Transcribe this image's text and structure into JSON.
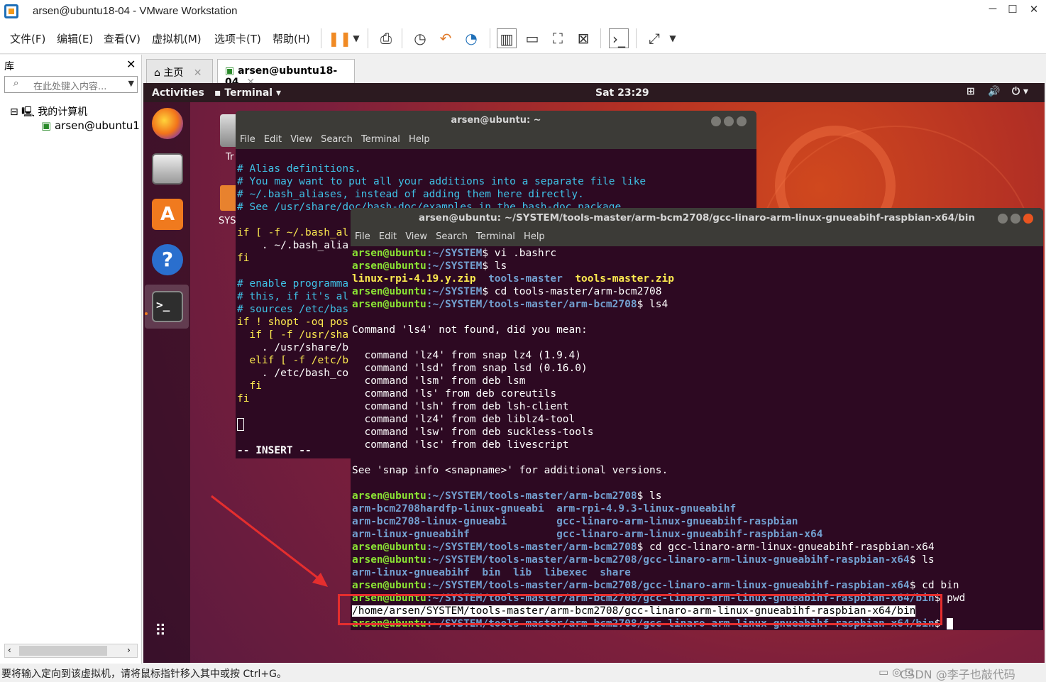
{
  "window": {
    "title": "arsen@ubuntu18-04 - VMware Workstation",
    "min": "─",
    "max": "☐",
    "close": "✕"
  },
  "menu": [
    "文件(F)",
    "编辑(E)",
    "查看(V)",
    "虚拟机(M)",
    "选项卡(T)",
    "帮助(H)"
  ],
  "library": {
    "title": "库",
    "close": "✕",
    "search_placeholder": "在此处键入内容...",
    "root": "我的计算机",
    "vm": "arsen@ubuntu18-04"
  },
  "tabs": [
    {
      "label": "主页"
    },
    {
      "label": "arsen@ubuntu18-04"
    }
  ],
  "ubuntu": {
    "activities": "Activities",
    "app": "Terminal ▾",
    "clock": "Sat 23:29"
  },
  "desktop": {
    "trash_label": "Tr",
    "folder_label": "SYS"
  },
  "term_back": {
    "title": "arsen@ubuntu: ~",
    "menu": "File Edit View Search Terminal Help",
    "lines": [
      "# Alias definitions.",
      "# You may want to put all your additions into a separate file like",
      "# ~/.bash_aliases, instead of adding them here directly.",
      "# See /usr/share/doc/bash-doc/examples in the bash-doc package."
    ],
    "lines2": [
      "if [ -f ~/.bash_al",
      "    . ~/.bash_alia",
      "fi",
      "",
      "# enable programma",
      "# this, if it's al",
      "# sources /etc/bas",
      "if ! shopt -oq pos",
      "  if [ -f /usr/sha",
      "    . /usr/share/b",
      "  elif [ -f /etc/b",
      "    . /etc/bash_co",
      "  fi",
      "fi"
    ],
    "mode": "-- INSERT --"
  },
  "term_front": {
    "title": "arsen@ubuntu: ~/SYSTEM/tools-master/arm-bcm2708/gcc-linaro-arm-linux-gnueabihf-raspbian-x64/bin",
    "menu": "File Edit View Search Terminal Help",
    "prompt_user": "arsen@ubuntu",
    "l1_path": ":~/SYSTEM",
    "l1_cmd": "$ vi .bashrc",
    "l2_path": ":~/SYSTEM",
    "l2_cmd": "$ ls",
    "ls1": [
      "linux-rpi-4.19.y.zip",
      "tools-master",
      "tools-master.zip"
    ],
    "l3_path": ":~/SYSTEM",
    "l3_cmd": "$ cd tools-master/arm-bcm2708",
    "l4_path": ":~/SYSTEM/tools-master/arm-bcm2708",
    "l4_cmd": "$ ls4",
    "notfound": "Command 'ls4' not found, did you mean:",
    "suggest": [
      "  command 'lz4' from snap lz4 (1.9.4)",
      "  command 'lsd' from snap lsd (0.16.0)",
      "  command 'lsm' from deb lsm",
      "  command 'ls' from deb coreutils",
      "  command 'lsh' from deb lsh-client",
      "  command 'lz4' from deb liblz4-tool",
      "  command 'lsw' from deb suckless-tools",
      "  command 'lsc' from deb livescript"
    ],
    "seeinfo": "See 'snap info <snapname>' for additional versions.",
    "l5_path": ":~/SYSTEM/tools-master/arm-bcm2708",
    "l5_cmd": "$ ls",
    "ls2": [
      "arm-bcm2708hardfp-linux-gnueabi  arm-rpi-4.9.3-linux-gnueabihf",
      "arm-bcm2708-linux-gnueabi        gcc-linaro-arm-linux-gnueabihf-raspbian",
      "arm-linux-gnueabihf              gcc-linaro-arm-linux-gnueabihf-raspbian-x64"
    ],
    "l6_path": ":~/SYSTEM/tools-master/arm-bcm2708",
    "l6_cmd": "$ cd gcc-linaro-arm-linux-gnueabihf-raspbian-x64",
    "l7_path": ":~/SYSTEM/tools-master/arm-bcm2708/gcc-linaro-arm-linux-gnueabihf-raspbian-x64",
    "l7_cmd": "$ ls",
    "ls3": "arm-linux-gnueabihf  bin  lib  libexec  share",
    "l8_path": ":~/SYSTEM/tools-master/arm-bcm2708/gcc-linaro-arm-linux-gnueabihf-raspbian-x64",
    "l8_cmd": "$ cd bin",
    "l9_path": ":~/SYSTEM/tools-master/arm-bcm2708/gcc-linaro-arm-linux-gnueabihf-raspbian-x64/bin",
    "l9_cmd": "$ pwd",
    "pwd_out": "/home/arsen/SYSTEM/tools-master/arm-bcm2708/gcc-linaro-arm-linux-gnueabihf-raspbian-x64/bin",
    "l10_path": ":~/SYSTEM/tools-master/arm-bcm2708/gcc-linaro-arm-linux-gnueabihf-raspbian-x64/bin",
    "l10_cmd": "$ "
  },
  "status": "要将输入定向到该虚拟机，请将鼠标指针移入其中或按 Ctrl+G。",
  "watermark": "CSDN @李子也敲代码",
  "colors": {
    "highlight": "#e52e2e",
    "prompt": "#8ae234",
    "dir": "#729fcf",
    "comment": "#3fc1e6"
  }
}
